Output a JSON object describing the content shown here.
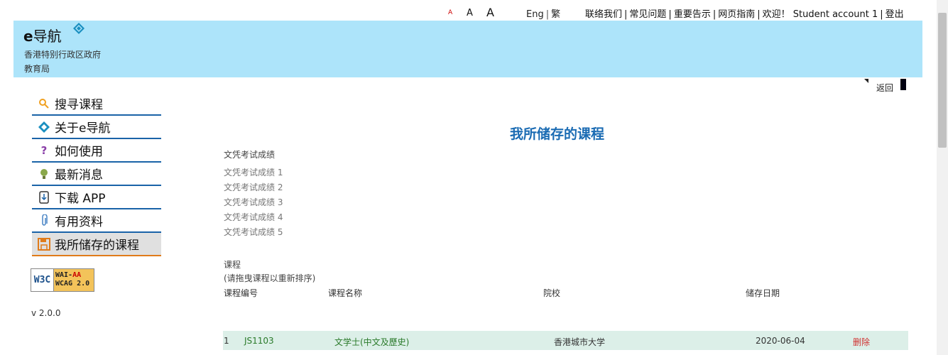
{
  "topbar": {
    "font_small": "A",
    "font_medium": "A",
    "font_large": "A",
    "lang_eng": "Eng",
    "lang_trad": "繁",
    "contact": "联络我们",
    "faq": "常见问题",
    "notice": "重要告示",
    "guide": "网页指南",
    "welcome": "欢迎！ Student account 1",
    "logout": "登出"
  },
  "header": {
    "brand_prefix": "e",
    "brand_name": "导航",
    "gov_line1": "香港特别行政区政府",
    "gov_line2": "教育局"
  },
  "back_label": "返回",
  "sidebar": {
    "items": [
      {
        "label": "搜寻课程",
        "icon": "search-icon"
      },
      {
        "label": "关于e导航",
        "icon": "compass-icon"
      },
      {
        "label": "如何使用",
        "icon": "question-icon"
      },
      {
        "label": "最新消息",
        "icon": "lightbulb-icon"
      },
      {
        "label": "下载 APP",
        "icon": "download-icon"
      },
      {
        "label": "有用资料",
        "icon": "paperclip-icon"
      },
      {
        "label": "我所储存的课程",
        "icon": "save-icon"
      }
    ],
    "badge_left": "W3C",
    "badge_line1_a": "WAI-",
    "badge_line1_b": "AA",
    "badge_line2": "WCAG 2.0",
    "version": "v 2.0.0"
  },
  "main": {
    "title": "我所储存的课程",
    "dse_heading": "文凭考试成绩",
    "dse_items": [
      "文凭考试成绩 1",
      "文凭考试成绩 2",
      "文凭考试成绩 3",
      "文凭考试成绩 4",
      "文凭考试成绩 5"
    ],
    "course_heading": "课程",
    "course_hint": "(请拖曳课程以重新排序)",
    "columns": [
      "课程编号",
      "课程名称",
      "院校",
      "储存日期"
    ],
    "rows": [
      {
        "index": "1",
        "code": "JS1103",
        "name": "文学士(中文及歷史)",
        "school": "香港城市大学",
        "date": "2020-06-04",
        "action": "删除"
      }
    ]
  },
  "colors": {
    "header_bg": "#ade4fa",
    "title": "#1a6bb3",
    "nav_border": "#1a63a8",
    "active_border": "#e07b1a",
    "row_bg": "#dcefe8",
    "delete": "#d03030"
  }
}
